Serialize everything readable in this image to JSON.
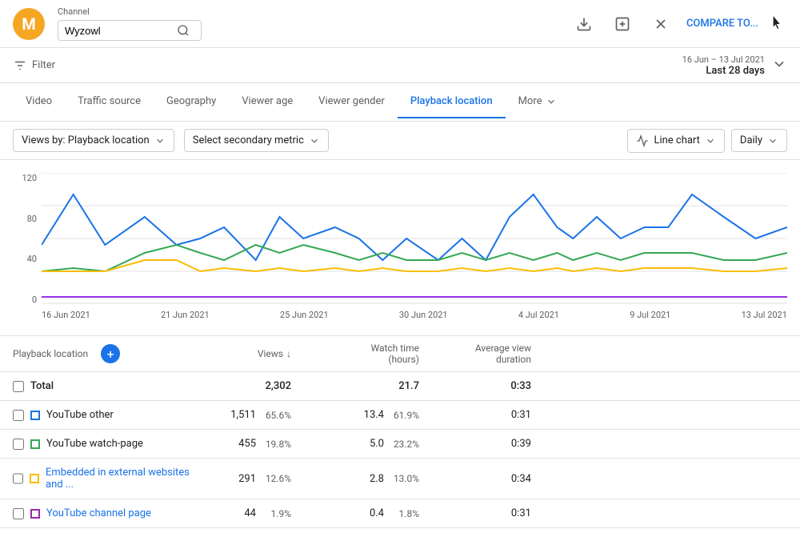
{
  "header": {
    "channel_label": "Channel",
    "search_value": "Wyzowl",
    "search_placeholder": "Search",
    "compare_label": "COMPARE TO...",
    "icons": [
      "download",
      "flag",
      "close"
    ]
  },
  "filter_bar": {
    "filter_label": "Filter",
    "date_range": "16 Jun – 13 Jul 2021",
    "date_period": "Last 28 days"
  },
  "tabs": {
    "items": [
      {
        "label": "Video",
        "active": false
      },
      {
        "label": "Traffic source",
        "active": false
      },
      {
        "label": "Geography",
        "active": false
      },
      {
        "label": "Viewer age",
        "active": false
      },
      {
        "label": "Viewer gender",
        "active": false
      },
      {
        "label": "Playback location",
        "active": true
      },
      {
        "label": "More",
        "active": false
      }
    ]
  },
  "controls": {
    "primary_metric": "Views by: Playback location",
    "secondary_metric": "Select secondary metric",
    "chart_type": "Line chart",
    "granularity": "Daily"
  },
  "chart": {
    "y_labels": [
      "120",
      "80",
      "40",
      "0"
    ],
    "x_labels": [
      "16 Jun 2021",
      "21 Jun 2021",
      "25 Jun 2021",
      "30 Jun 2021",
      "4 Jul 2021",
      "9 Jul 2021",
      "13 Jul 2021"
    ]
  },
  "table": {
    "title": "Playback location",
    "add_btn": "+",
    "columns": [
      {
        "label": "Views",
        "sortable": true
      },
      {
        "label": "Watch time\n(hours)"
      },
      {
        "label": "Average view\nduration"
      }
    ],
    "total_row": {
      "label": "Total",
      "views": "2,302",
      "watch_time": "21.7",
      "avg_duration": "0:33"
    },
    "rows": [
      {
        "color": "blue",
        "label": "YouTube other",
        "views": "1,511",
        "views_pct": "65.6%",
        "watch_time": "13.4",
        "watch_time_pct": "61.9%",
        "avg_duration": "0:31"
      },
      {
        "color": "green",
        "label": "YouTube watch-page",
        "views": "455",
        "views_pct": "19.8%",
        "watch_time": "5.0",
        "watch_time_pct": "23.2%",
        "avg_duration": "0:39"
      },
      {
        "color": "orange",
        "label": "Embedded in external websites and ...",
        "views": "291",
        "views_pct": "12.6%",
        "watch_time": "2.8",
        "watch_time_pct": "13.0%",
        "avg_duration": "0:34",
        "is_link": true
      },
      {
        "color": "purple",
        "label": "YouTube channel page",
        "views": "44",
        "views_pct": "1.9%",
        "watch_time": "0.4",
        "watch_time_pct": "1.8%",
        "avg_duration": "0:31",
        "is_link": true
      }
    ]
  },
  "colors": {
    "blue": "#1a73e8",
    "green": "#34a853",
    "orange": "#fbbc04",
    "purple": "#9334e6",
    "accent": "#1a73e8"
  }
}
